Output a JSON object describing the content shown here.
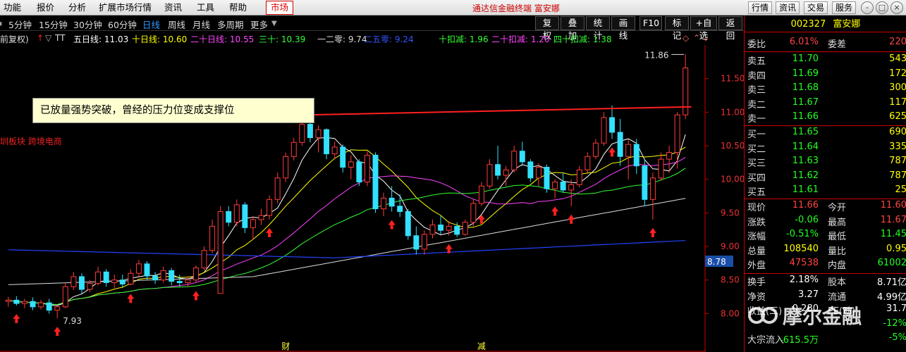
{
  "menu": [
    "功能",
    "报价",
    "分析",
    "扩展市场行情",
    "资讯",
    "工具",
    "帮助"
  ],
  "market_label": "市场",
  "app_title": "通达信金融终端  富安娜",
  "right_tools": [
    "行情",
    "资讯",
    "交易",
    "服务"
  ],
  "window_buttons": [
    "-",
    "□",
    "×"
  ],
  "periods": [
    "5分钟",
    "15分钟",
    "30分钟",
    "60分钟",
    "日线",
    "周线",
    "月线",
    "多周期",
    "更多"
  ],
  "active_period": "日线",
  "tools": [
    "复权",
    "叠加",
    "统计",
    "画线",
    "F10",
    "标记",
    "+自选",
    "返回"
  ],
  "ma_row": {
    "prefix": "前复权)",
    "tt": "TT",
    "items": [
      {
        "label": "五日线: 11.03",
        "color": "#ffffff"
      },
      {
        "label": "十日线: 10.60",
        "color": "#ffff00"
      },
      {
        "label": "二十日线: 10.55",
        "color": "#ff44ff"
      },
      {
        "label": "三十: 10.39",
        "color": "#33ff33"
      },
      {
        "label": "一二零: 9.74",
        "color": "#dddddd"
      },
      {
        "label": "二五零: 9.24",
        "color": "#3355ff"
      },
      {
        "label": "十扣减: 1.96",
        "color": "#33ff33"
      },
      {
        "label": "二十扣减: 1.20",
        "color": "#ff44ff"
      },
      {
        "label": "四十扣减: 1.38",
        "color": "#33ff33"
      }
    ]
  },
  "annotation": "已放量强势突破，曾经的压力位变成支撑位",
  "sector_label": "圳板块 跨境电商",
  "chart_data": {
    "type": "candlestick",
    "ylim": [
      7.7,
      12.0
    ],
    "y_ticks": [
      "11.50",
      "11.00",
      "10.50",
      "10.00",
      "9.50",
      "9.00",
      "8.50",
      "8.00"
    ],
    "current_price_marker": "8.78",
    "peak_label": "11.86",
    "low_label": "7.93",
    "bottom_markers": [
      {
        "label": "财",
        "index": 34
      },
      {
        "label": "减",
        "index": 58
      }
    ],
    "resistance_line": {
      "start_index": 37,
      "end_index": 82,
      "start_value": 10.96,
      "end_value": 11.08
    },
    "buy_arrow_indices": [
      1,
      6,
      15,
      23,
      32,
      47,
      54,
      58,
      67,
      69,
      74,
      79
    ],
    "candles": [
      [
        8.18,
        8.25,
        8.1,
        8.2
      ],
      [
        8.2,
        8.26,
        8.12,
        8.15
      ],
      [
        8.15,
        8.22,
        8.08,
        8.18
      ],
      [
        8.18,
        8.24,
        8.05,
        8.1
      ],
      [
        8.1,
        8.2,
        8.06,
        8.16
      ],
      [
        8.16,
        8.22,
        8.0,
        8.05
      ],
      [
        8.05,
        8.12,
        7.93,
        8.1
      ],
      [
        8.1,
        8.45,
        8.08,
        8.4
      ],
      [
        8.4,
        8.62,
        8.35,
        8.55
      ],
      [
        8.55,
        8.6,
        8.3,
        8.36
      ],
      [
        8.36,
        8.5,
        8.32,
        8.45
      ],
      [
        8.45,
        8.7,
        8.42,
        8.62
      ],
      [
        8.62,
        8.66,
        8.4,
        8.46
      ],
      [
        8.46,
        8.58,
        8.38,
        8.5
      ],
      [
        8.5,
        8.58,
        8.38,
        8.44
      ],
      [
        8.44,
        8.66,
        8.42,
        8.6
      ],
      [
        8.6,
        8.8,
        8.55,
        8.74
      ],
      [
        8.74,
        8.78,
        8.5,
        8.56
      ],
      [
        8.56,
        8.62,
        8.44,
        8.5
      ],
      [
        8.5,
        8.7,
        8.46,
        8.64
      ],
      [
        8.64,
        8.68,
        8.42,
        8.48
      ],
      [
        8.48,
        8.58,
        8.4,
        8.46
      ],
      [
        8.46,
        8.56,
        8.4,
        8.5
      ],
      [
        8.5,
        8.72,
        8.46,
        8.68
      ],
      [
        8.68,
        9.0,
        8.64,
        8.94
      ],
      [
        8.94,
        9.4,
        8.9,
        9.3
      ],
      [
        8.3,
        9.6,
        9.26,
        9.52
      ],
      [
        9.52,
        9.6,
        9.3,
        9.36
      ],
      [
        9.36,
        9.7,
        9.3,
        9.62
      ],
      [
        9.62,
        9.66,
        9.2,
        9.28
      ],
      [
        9.28,
        9.45,
        9.1,
        9.4
      ],
      [
        9.4,
        9.56,
        9.32,
        9.46
      ],
      [
        9.46,
        9.76,
        9.4,
        9.7
      ],
      [
        9.7,
        10.1,
        9.64,
        10.02
      ],
      [
        10.02,
        10.4,
        9.96,
        10.34
      ],
      [
        10.34,
        10.62,
        10.28,
        10.55
      ],
      [
        10.55,
        10.9,
        10.5,
        10.82
      ],
      [
        10.82,
        10.95,
        10.55,
        10.62
      ],
      [
        10.62,
        10.8,
        10.4,
        10.74
      ],
      [
        10.74,
        10.76,
        10.3,
        10.38
      ],
      [
        10.38,
        10.56,
        10.3,
        10.48
      ],
      [
        10.48,
        10.52,
        10.1,
        10.18
      ],
      [
        10.18,
        10.36,
        10.0,
        10.26
      ],
      [
        10.26,
        10.3,
        9.9,
        9.96
      ],
      [
        9.96,
        10.42,
        9.9,
        10.36
      ],
      [
        10.36,
        10.4,
        9.5,
        9.56
      ],
      [
        9.56,
        9.8,
        9.45,
        9.72
      ],
      [
        9.72,
        9.9,
        9.52,
        9.6
      ],
      [
        9.6,
        9.78,
        9.44,
        9.52
      ],
      [
        9.52,
        9.56,
        9.1,
        9.16
      ],
      [
        9.16,
        9.3,
        8.88,
        8.96
      ],
      [
        8.96,
        9.24,
        8.88,
        9.18
      ],
      [
        9.18,
        9.4,
        9.12,
        9.32
      ],
      [
        9.32,
        9.46,
        9.18,
        9.24
      ],
      [
        9.24,
        9.38,
        9.16,
        9.3
      ],
      [
        9.3,
        9.36,
        9.14,
        9.18
      ],
      [
        9.18,
        9.4,
        9.16,
        9.36
      ],
      [
        9.36,
        9.7,
        9.3,
        9.64
      ],
      [
        9.64,
        9.96,
        9.6,
        9.9
      ],
      [
        9.9,
        10.3,
        9.86,
        10.22
      ],
      [
        10.22,
        10.5,
        10.0,
        10.06
      ],
      [
        10.06,
        10.2,
        9.9,
        10.14
      ],
      [
        10.14,
        10.5,
        10.1,
        10.42
      ],
      [
        10.42,
        10.56,
        10.2,
        10.26
      ],
      [
        10.26,
        10.3,
        9.96,
        10.02
      ],
      [
        10.02,
        10.24,
        9.9,
        10.18
      ],
      [
        10.18,
        10.22,
        9.8,
        9.86
      ],
      [
        9.86,
        10.0,
        9.72,
        9.96
      ],
      [
        9.96,
        10.1,
        9.8,
        9.84
      ],
      [
        9.84,
        10.0,
        9.6,
        9.92
      ],
      [
        9.92,
        10.2,
        9.88,
        10.14
      ],
      [
        10.14,
        10.4,
        10.1,
        10.34
      ],
      [
        10.34,
        10.6,
        10.3,
        10.54
      ],
      [
        10.54,
        11.0,
        10.5,
        10.92
      ],
      [
        10.92,
        11.1,
        10.6,
        10.7
      ],
      [
        10.7,
        10.9,
        10.2,
        10.34
      ],
      [
        10.34,
        10.6,
        10.0,
        10.52
      ],
      [
        10.52,
        10.6,
        10.08,
        10.2
      ],
      [
        10.2,
        10.3,
        9.6,
        9.7
      ],
      [
        9.7,
        10.1,
        9.4,
        10.02
      ],
      [
        10.02,
        10.4,
        9.98,
        10.3
      ],
      [
        10.3,
        10.5,
        10.1,
        10.4
      ],
      [
        10.4,
        11.0,
        10.16,
        10.96
      ],
      [
        10.96,
        11.86,
        10.9,
        11.66
      ]
    ]
  },
  "panel": {
    "code": "002327",
    "name": "富安娜",
    "weibi": {
      "label": "委比",
      "value": "6.01%",
      "label2": "委差",
      "value2": "220"
    },
    "sells": [
      {
        "label": "卖五",
        "price": "11.70",
        "vol": "543"
      },
      {
        "label": "卖四",
        "price": "11.69",
        "vol": "172"
      },
      {
        "label": "卖三",
        "price": "11.68",
        "vol": "300"
      },
      {
        "label": "卖二",
        "price": "11.67",
        "vol": "117"
      },
      {
        "label": "卖一",
        "price": "11.66",
        "vol": "625"
      }
    ],
    "buys": [
      {
        "label": "买一",
        "price": "11.65",
        "vol": "690"
      },
      {
        "label": "买二",
        "price": "11.64",
        "vol": "335"
      },
      {
        "label": "买三",
        "price": "11.63",
        "vol": "787"
      },
      {
        "label": "买四",
        "price": "11.62",
        "vol": "787"
      },
      {
        "label": "买五",
        "price": "11.61",
        "vol": "25"
      }
    ],
    "stats": [
      {
        "label": "现价",
        "value": "11.66",
        "vc": "red",
        "label2": "今开",
        "value2": "11.60",
        "vc2": "red"
      },
      {
        "label": "涨跌",
        "value": "-0.06",
        "vc": "green",
        "label2": "最高",
        "value2": "11.67",
        "vc2": "red"
      },
      {
        "label": "涨幅",
        "value": "-0.51%",
        "vc": "green",
        "label2": "最低",
        "value2": "11.45",
        "vc2": "green"
      },
      {
        "label": "总量",
        "value": "108540",
        "vc": "yellow",
        "label2": "量比",
        "value2": "0.95",
        "vc2": "yellow"
      },
      {
        "label": "外盘",
        "value": "47538",
        "vc": "red",
        "label2": "内盘",
        "value2": "61002",
        "vc2": "green"
      }
    ],
    "stats2": [
      {
        "label": "换手",
        "value": "2.18%",
        "vc": "white",
        "label2": "股本",
        "value2": "8.71亿",
        "vc2": "white"
      },
      {
        "label": "净资",
        "value": "3.27",
        "vc": "white",
        "label2": "流通",
        "value2": "4.99亿",
        "vc2": "white"
      },
      {
        "label": "收益(三)",
        "value": "0.280",
        "vc": "white",
        "label2": "PE(动)",
        "value2": "31.7",
        "vc2": "white"
      },
      {
        "label": "",
        "value": "",
        "vc": "white",
        "label2": "",
        "value2": "-12%",
        "vc2": "green"
      },
      {
        "label": "大宗流入",
        "value": "-615.5万",
        "vc": "green",
        "label2": "",
        "value2": "-5%",
        "vc2": "green"
      }
    ]
  },
  "watermark": "摩尔金融"
}
